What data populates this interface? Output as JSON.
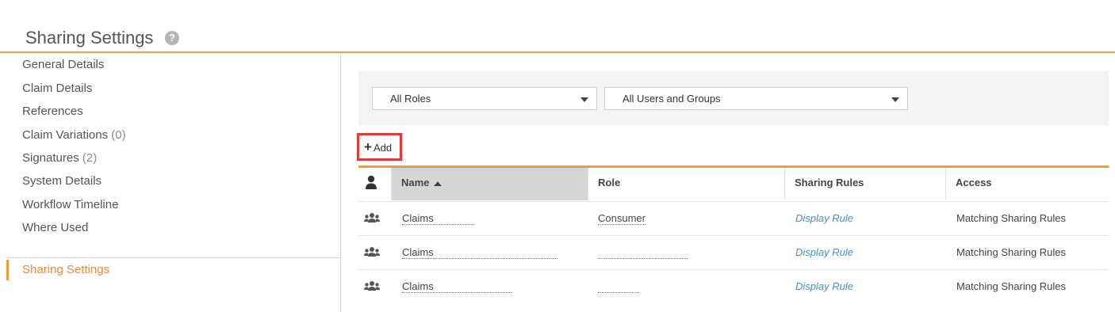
{
  "header": {
    "title": "Sharing Settings",
    "help_icon": "question-circle-icon"
  },
  "sidebar": {
    "items": [
      {
        "label": "General Details",
        "count": ""
      },
      {
        "label": "Claim Details",
        "count": ""
      },
      {
        "label": "References",
        "count": ""
      },
      {
        "label": "Claim Variations",
        "count": "(0)"
      },
      {
        "label": "Signatures",
        "count": "(2)"
      },
      {
        "label": "System Details",
        "count": ""
      },
      {
        "label": "Workflow Timeline",
        "count": ""
      },
      {
        "label": "Where Used",
        "count": ""
      }
    ],
    "active_item": "Sharing Settings"
  },
  "filters": {
    "roles": {
      "selected": "All Roles"
    },
    "users_groups": {
      "selected": "All Users and Groups"
    }
  },
  "toolbar": {
    "add_label": "Add"
  },
  "grid": {
    "columns": {
      "icon": "user-icon",
      "name": "Name",
      "role": "Role",
      "rules": "Sharing Rules",
      "access": "Access"
    },
    "sort": {
      "column": "Name",
      "direction": "ascending"
    },
    "rows": [
      {
        "icon": "group-icon",
        "name": "Claims",
        "role": "Consumer",
        "rules": "Display Rule",
        "access": "Matching Sharing Rules"
      },
      {
        "icon": "group-icon",
        "name": "Claims",
        "role": "",
        "rules": "Display Rule",
        "access": "Matching Sharing Rules"
      },
      {
        "icon": "group-icon",
        "name": "Claims",
        "role": "",
        "rules": "Display Rule",
        "access": "Matching Sharing Rules"
      }
    ]
  },
  "colors": {
    "accent": "#f29a3c",
    "active_text": "#ee8a3a",
    "link": "#4a90c8",
    "highlight": "#e53935"
  }
}
